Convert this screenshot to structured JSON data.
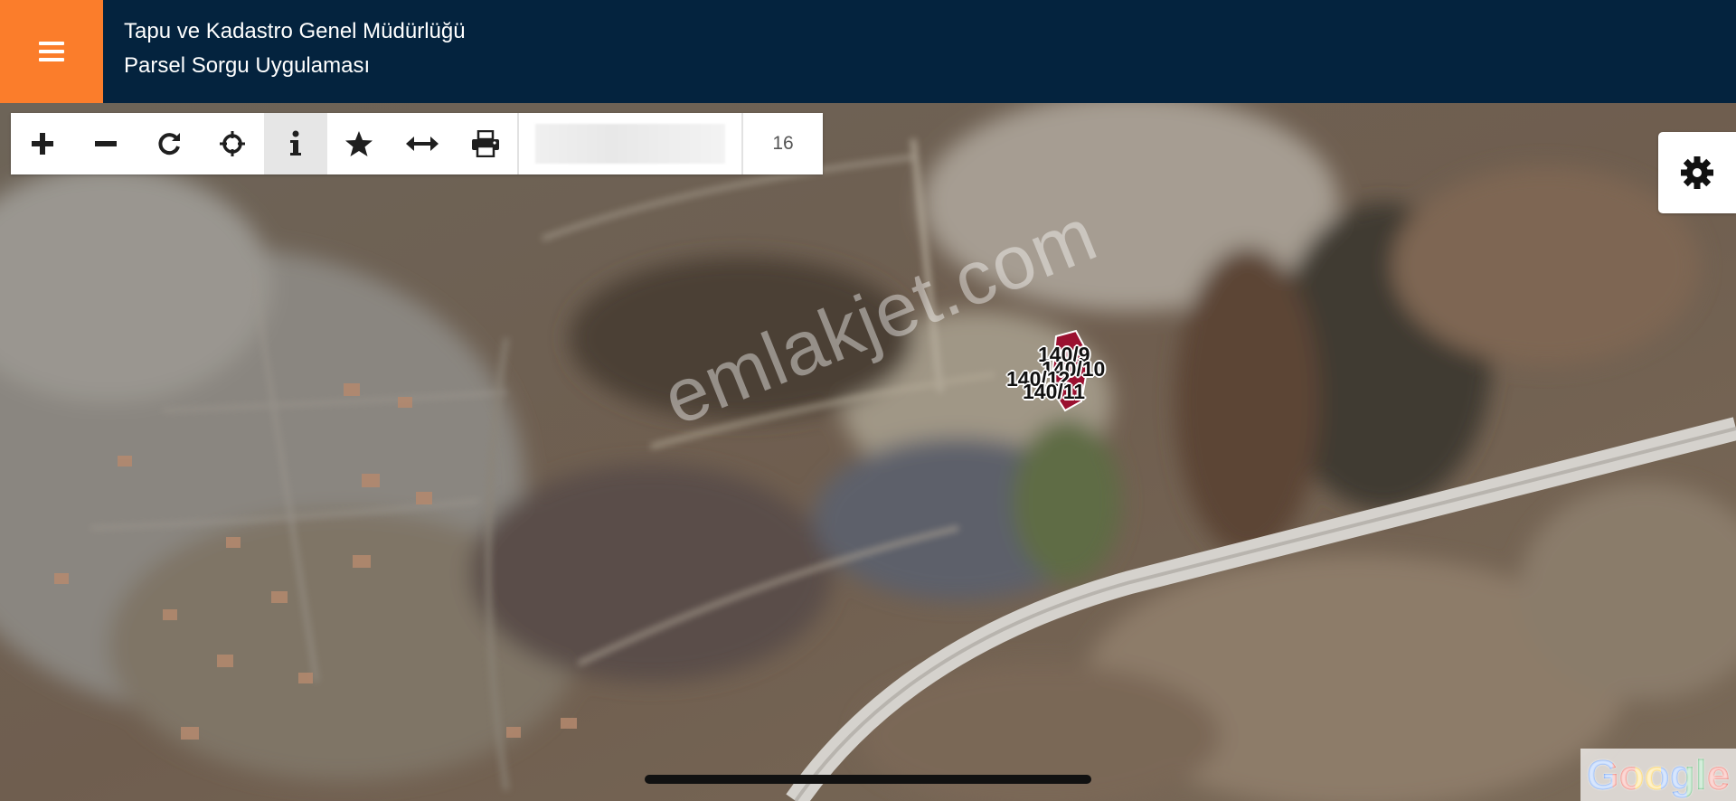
{
  "header": {
    "title_line1": "Tapu ve Kadastro Genel Müdürlüğü",
    "title_line2": "Parsel Sorgu Uygulaması",
    "menu_icon": "hamburger-menu-icon",
    "header_color": "#04233e",
    "menu_color": "#fb7d2b"
  },
  "toolbar": {
    "tools": [
      {
        "name": "zoom-in",
        "icon": "plus-icon"
      },
      {
        "name": "zoom-out",
        "icon": "minus-icon"
      },
      {
        "name": "refresh",
        "icon": "refresh-icon"
      },
      {
        "name": "locate",
        "icon": "crosshair-icon"
      },
      {
        "name": "info",
        "icon": "info-icon",
        "active": true
      },
      {
        "name": "favorites",
        "icon": "star-icon"
      },
      {
        "name": "measure",
        "icon": "arrows-horizontal-icon"
      },
      {
        "name": "print",
        "icon": "printer-icon"
      }
    ],
    "search_value": "",
    "zoom_level": "16"
  },
  "settings": {
    "icon": "gear-icon"
  },
  "map": {
    "basemap": "satellite",
    "parcels": [
      {
        "label": "140/9",
        "highlight_color": "#9b1030"
      },
      {
        "label": "140/10",
        "highlight_color": "#9b1030"
      },
      {
        "label": "140/12",
        "highlight_color": "#9b1030"
      },
      {
        "label": "140/11",
        "highlight_color": "#9b1030"
      }
    ],
    "watermark": "emlakjet.com",
    "attribution": "Google"
  }
}
